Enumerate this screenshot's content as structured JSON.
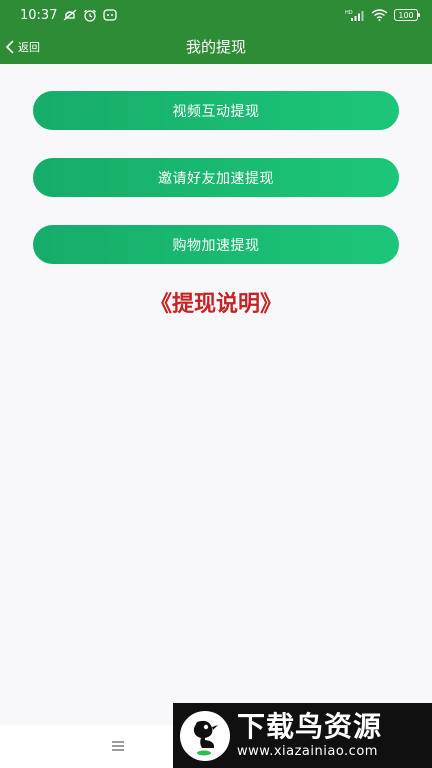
{
  "status_bar": {
    "time": "10:37",
    "battery": "100",
    "network_label": "HD"
  },
  "header": {
    "back_label": "返回",
    "title": "我的提现"
  },
  "actions": [
    {
      "label": "视频互动提现"
    },
    {
      "label": "邀请好友加速提现"
    },
    {
      "label": "购物加速提现"
    }
  ],
  "explain_link": "《提现说明》",
  "watermark": {
    "title": "下载鸟资源",
    "url": "www.xiazainiao.com"
  },
  "colors": {
    "header_bg": "#2e8b36",
    "button_start": "#16ac69",
    "button_end": "#1dc67a",
    "link_red": "#c62424",
    "page_bg": "#f8f8fa"
  },
  "icons": {
    "back": "chevron-left-icon",
    "menu": "menu-icon",
    "wifi": "wifi-icon",
    "signal": "signal-icon"
  }
}
